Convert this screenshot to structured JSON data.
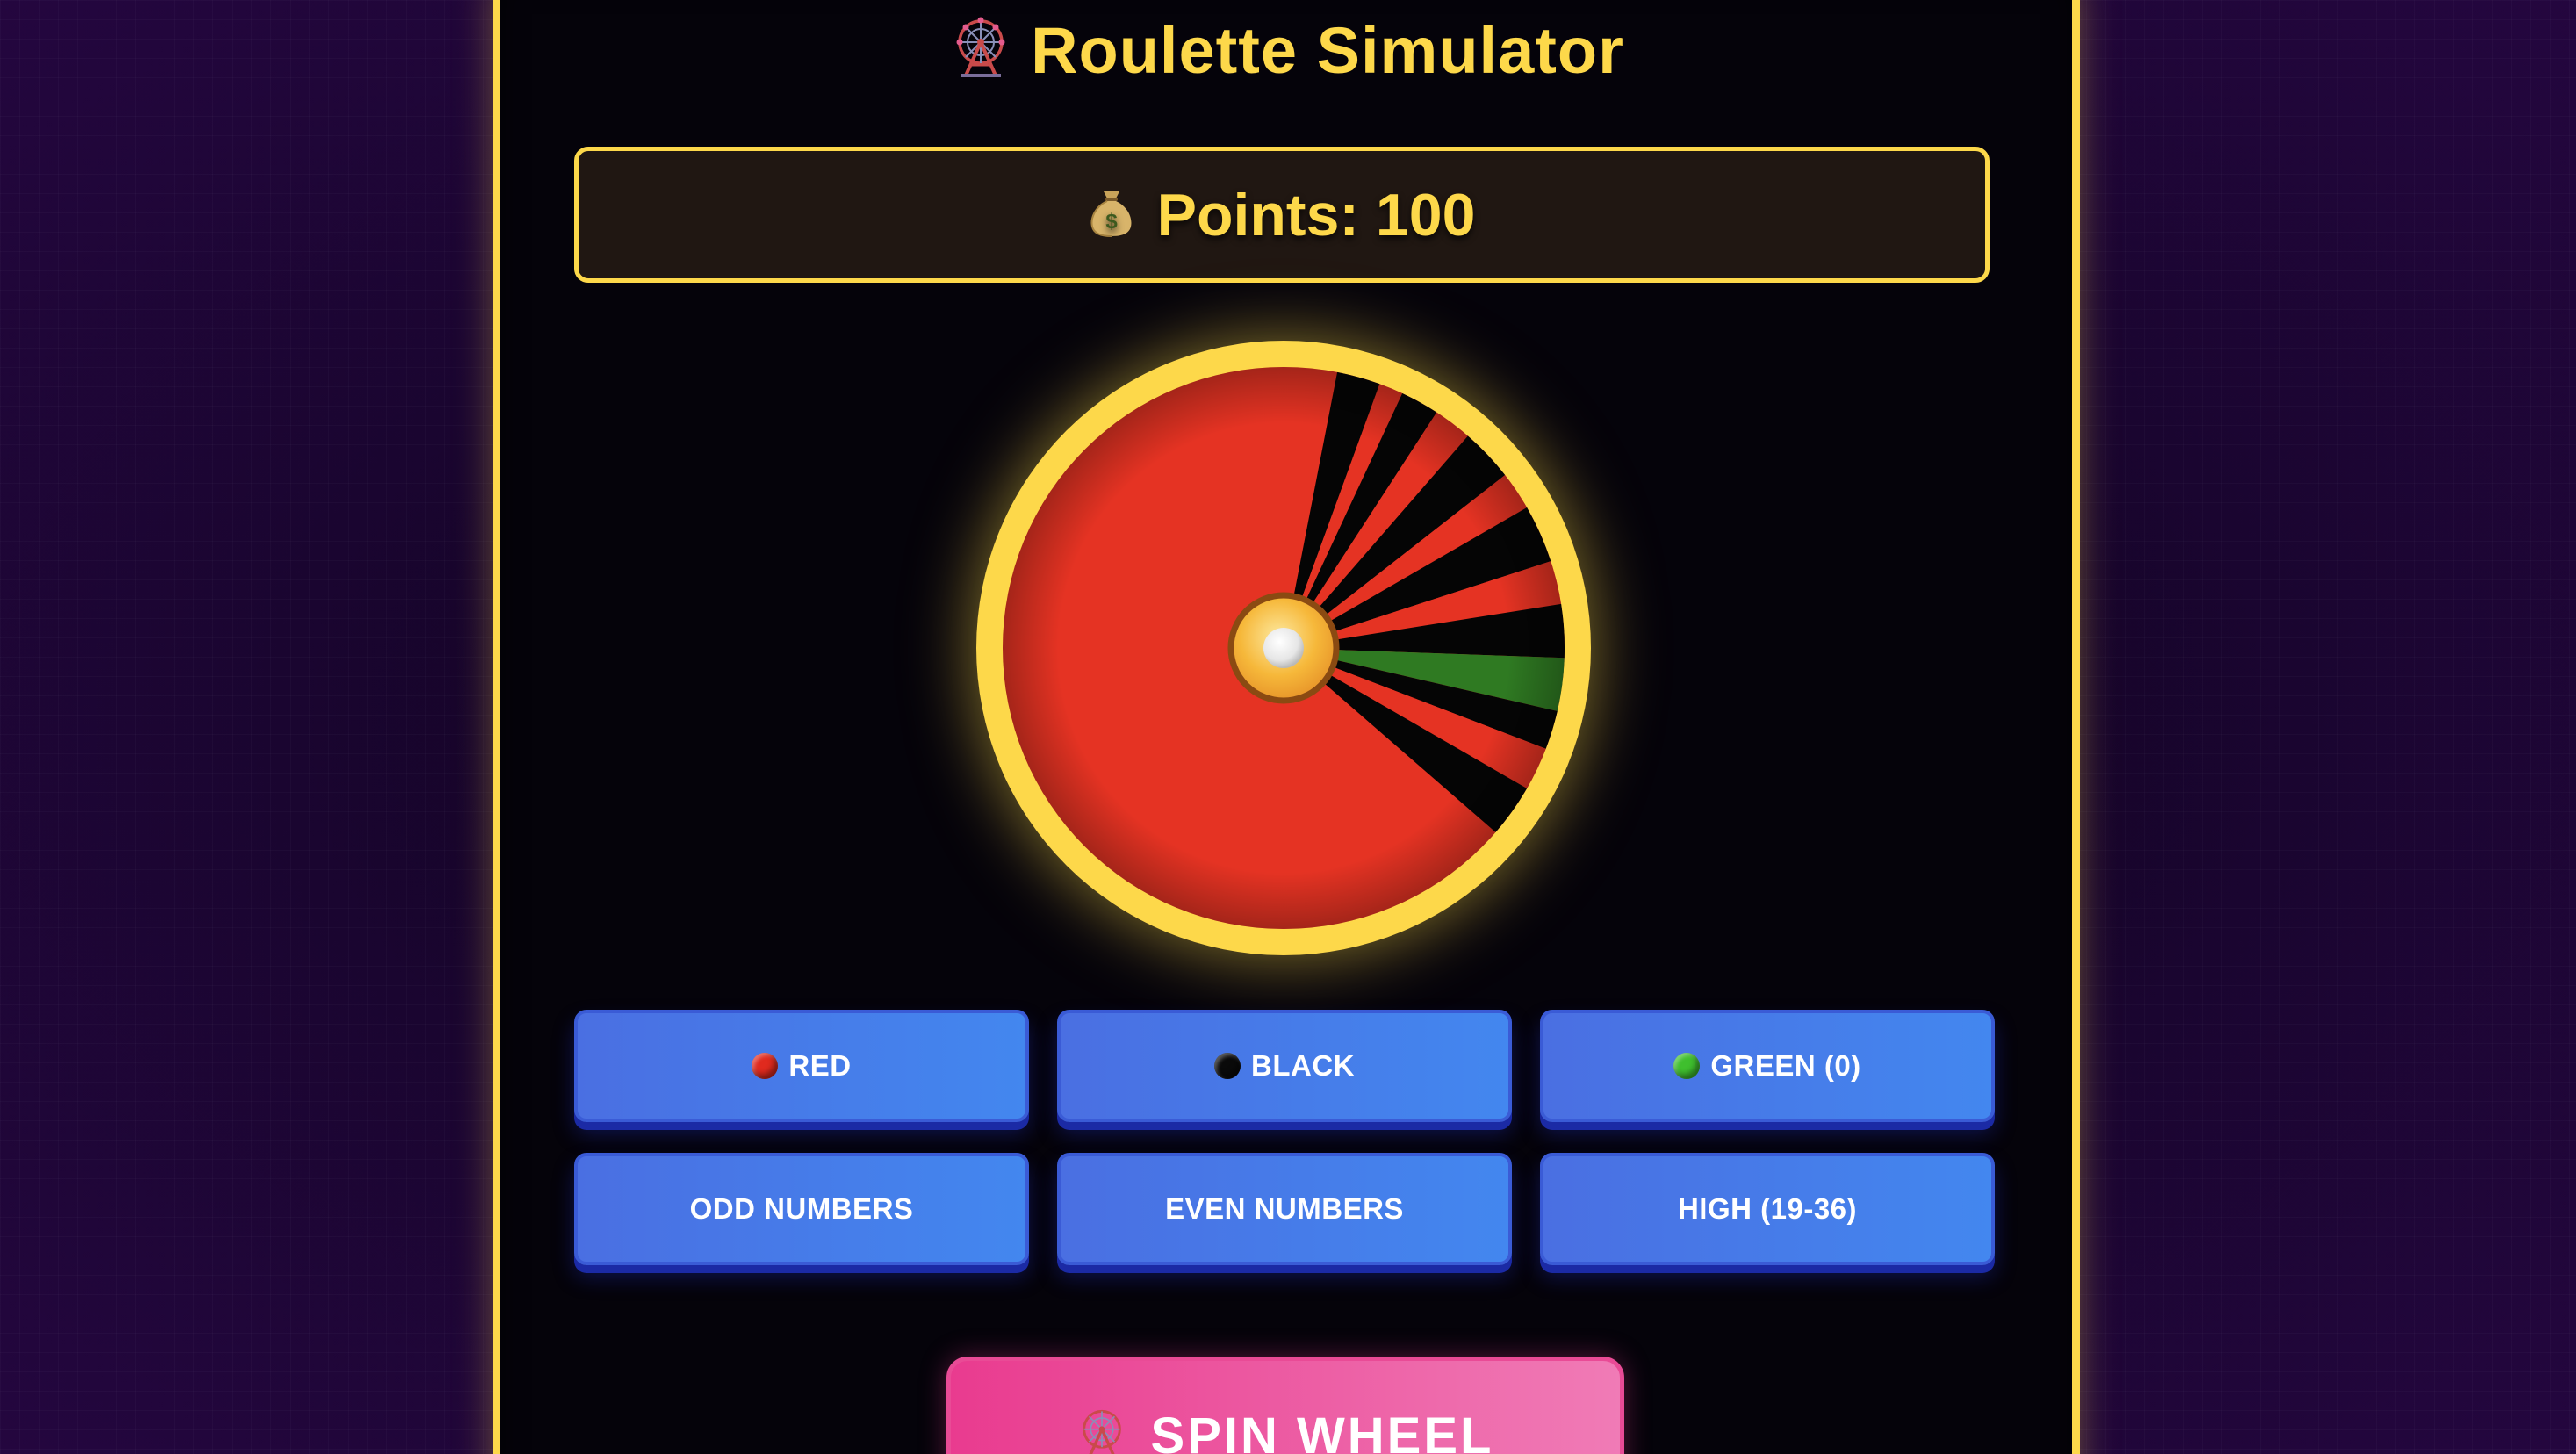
{
  "app": {
    "title": "Roulette Simulator",
    "title_icon": "ferris-wheel-icon"
  },
  "points": {
    "label": "Points: 100",
    "icon": "money-bag-icon"
  },
  "wheel": {
    "colors": {
      "red": "#e53323",
      "black": "#050505",
      "green": "#2f7a22",
      "rim": "#fdd84a",
      "hub": "#f5b93c"
    }
  },
  "bets": {
    "red": {
      "label": "RED",
      "icon": "red-ball-icon",
      "color": "#e02a1e"
    },
    "black": {
      "label": "BLACK",
      "icon": "black-ball-icon",
      "color": "#0a0a0a"
    },
    "green": {
      "label": "GREEN (0)",
      "icon": "green-ball-icon",
      "color": "#3fbf2e"
    },
    "odd": {
      "label": "ODD NUMBERS"
    },
    "even": {
      "label": "EVEN NUMBERS"
    },
    "high": {
      "label": "HIGH (19-36)"
    }
  },
  "spin": {
    "label": "SPIN WHEEL",
    "icon": "ferris-wheel-icon"
  },
  "theme": {
    "accent": "#fdd84a",
    "button_blue": "#4a78e8",
    "spin_pink": "#e93b8f"
  }
}
